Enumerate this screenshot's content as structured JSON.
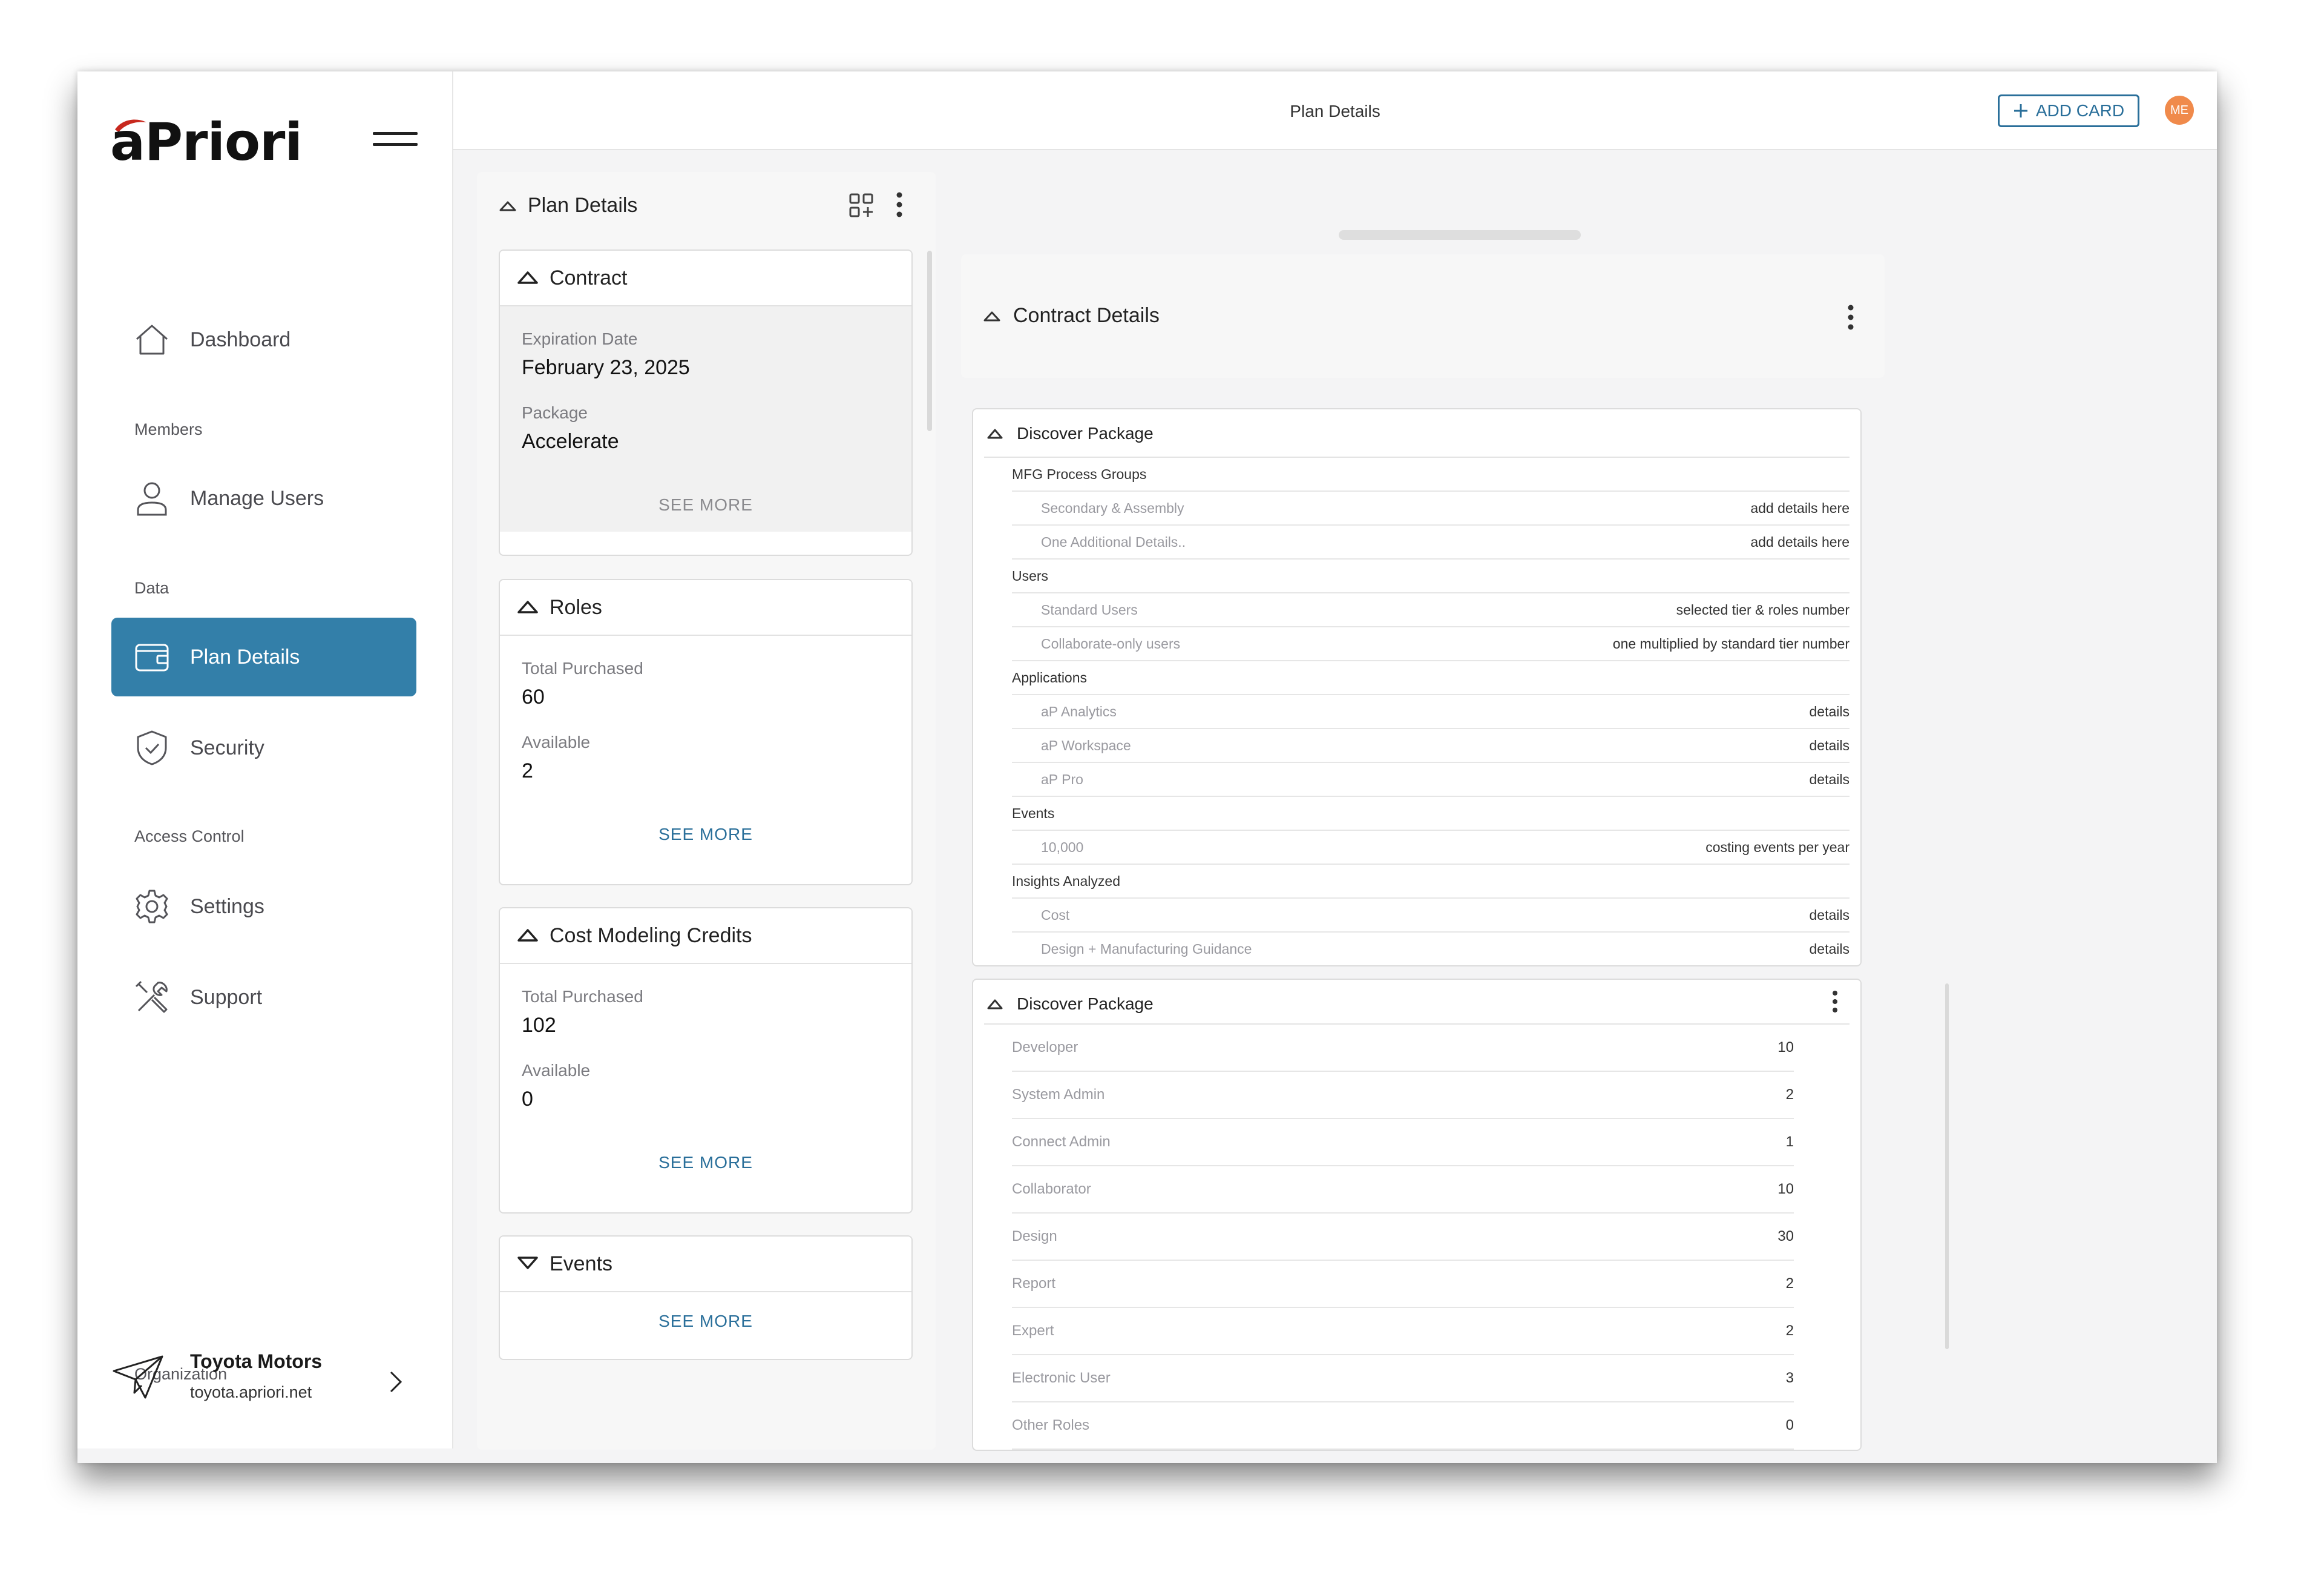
{
  "app": {
    "logo_text": "aPriori",
    "brand_color": "#337fa9",
    "accent_color": "#c8281e"
  },
  "sidebar": {
    "items": [
      {
        "label": "Dashboard",
        "icon": "home-icon"
      },
      {
        "label": "Manage Users",
        "icon": "user-icon"
      },
      {
        "label": "Plan Details",
        "icon": "wallet-icon",
        "active": true
      },
      {
        "label": "Security",
        "icon": "shield-check-icon"
      },
      {
        "label": "Settings",
        "icon": "gear-icon"
      },
      {
        "label": "Support",
        "icon": "tools-icon"
      }
    ],
    "sections": {
      "members": "Members",
      "data": "Data",
      "access_control": "Access Control",
      "organization": "Organization"
    },
    "org": {
      "name": "Toyota Motors",
      "url": "toyota.apriori.net"
    }
  },
  "header": {
    "title": "Plan Details",
    "add_card_label": "ADD CARD",
    "avatar_initials": "ME"
  },
  "plan_panel": {
    "title": "Plan Details",
    "cards": {
      "contract": {
        "title": "Contract",
        "fields": [
          {
            "key": "Expiration Date",
            "value": "February 23, 2025"
          },
          {
            "key": "Package",
            "value": "Accelerate"
          }
        ],
        "see_more": "SEE MORE"
      },
      "roles": {
        "title": "Roles",
        "fields": [
          {
            "key": "Total Purchased",
            "value": "60"
          },
          {
            "key": "Available",
            "value": "2"
          }
        ],
        "see_more": "SEE MORE"
      },
      "credits": {
        "title": "Cost Modeling Credits",
        "fields": [
          {
            "key": "Total Purchased",
            "value": "102"
          },
          {
            "key": "Available",
            "value": "0"
          }
        ],
        "see_more": "SEE MORE"
      },
      "events": {
        "title": "Events",
        "see_more": "SEE MORE"
      }
    }
  },
  "contract_details": {
    "title": "Contract Details"
  },
  "discover_package_1": {
    "title": "Discover Package",
    "rows": [
      {
        "label": "MFG Process Groups",
        "value": "",
        "group": true
      },
      {
        "label": "Secondary & Assembly",
        "value": "add details here"
      },
      {
        "label": "One Additional Details..",
        "value": "add details here"
      },
      {
        "label": "Users",
        "value": "",
        "group": true
      },
      {
        "label": "Standard Users",
        "value": "selected tier & roles number"
      },
      {
        "label": "Collaborate-only users",
        "value": "one multiplied by standard tier number"
      },
      {
        "label": "Applications",
        "value": "",
        "group": true
      },
      {
        "label": "aP Analytics",
        "value": "details"
      },
      {
        "label": "aP Workspace",
        "value": "details"
      },
      {
        "label": "aP Pro",
        "value": "details"
      },
      {
        "label": "Events",
        "value": "",
        "group": true
      },
      {
        "label": "10,000",
        "value": "costing events per year"
      },
      {
        "label": "Insights Analyzed",
        "value": "",
        "group": true
      },
      {
        "label": "Cost",
        "value": "details"
      },
      {
        "label": "Design + Manufacturing Guidance",
        "value": "details"
      }
    ]
  },
  "discover_package_2": {
    "title": "Discover Package",
    "rows": [
      {
        "label": "Developer",
        "value": "10"
      },
      {
        "label": "System Admin",
        "value": "2"
      },
      {
        "label": "Connect Admin",
        "value": "1"
      },
      {
        "label": "Collaborator",
        "value": "10"
      },
      {
        "label": "Design",
        "value": "30"
      },
      {
        "label": "Report",
        "value": "2"
      },
      {
        "label": "Expert",
        "value": "2"
      },
      {
        "label": "Electronic User",
        "value": "3"
      },
      {
        "label": "Other Roles",
        "value": "0"
      }
    ]
  }
}
